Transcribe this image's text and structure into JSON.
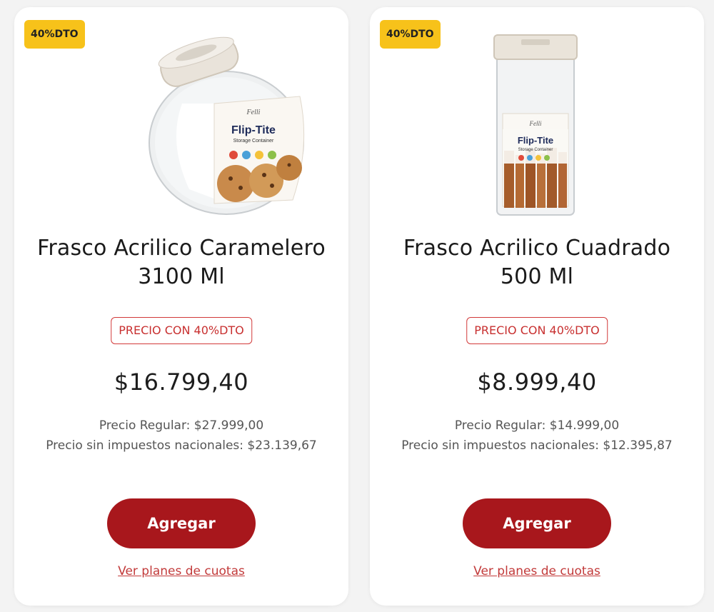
{
  "products": [
    {
      "badge": "40%DTO",
      "title_line1": "Frasco Acrilico Caramelero",
      "title_line2": "3100 Ml",
      "price_tag": "PRECIO CON 40%DTO",
      "price": "$16.799,40",
      "regular_price": "Precio Regular: $27.999,00",
      "no_tax_price": "Precio sin impuestos nacionales: $23.139,67",
      "add_label": "Agregar",
      "plans_label": "Ver planes de cuotas",
      "image": {
        "icon": "round-jar-image",
        "brand": "Felli",
        "label": "Flip-Tite",
        "sublabel": "Storage Container"
      }
    },
    {
      "badge": "40%DTO",
      "title_line1": "Frasco Acrilico Cuadrado",
      "title_line2": "500 Ml",
      "price_tag": "PRECIO CON 40%DTO",
      "price": "$8.999,40",
      "regular_price": "Precio Regular: $14.999,00",
      "no_tax_price": "Precio sin impuestos nacionales: $12.395,87",
      "add_label": "Agregar",
      "plans_label": "Ver planes de cuotas",
      "image": {
        "icon": "square-jar-image",
        "brand": "Felli",
        "label": "Flip-Tite",
        "sublabel": "Storage Container"
      }
    }
  ],
  "colors": {
    "badge": "#f7c21a",
    "button": "#a8171c",
    "accent": "#c83030",
    "background": "#f3f3f3"
  }
}
